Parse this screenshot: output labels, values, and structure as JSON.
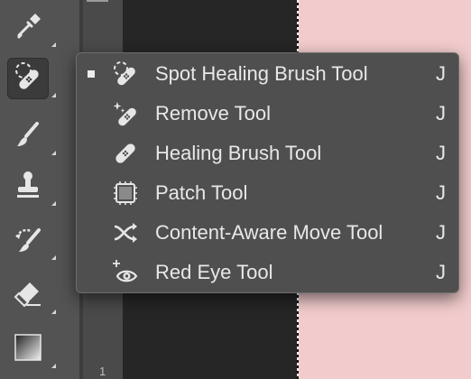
{
  "menu": {
    "items": [
      {
        "label": "Spot Healing Brush Tool",
        "shortcut": "J",
        "checked": true,
        "icon": "spot-healing-brush-icon"
      },
      {
        "label": "Remove Tool",
        "shortcut": "J",
        "checked": false,
        "icon": "remove-tool-icon"
      },
      {
        "label": "Healing Brush Tool",
        "shortcut": "J",
        "checked": false,
        "icon": "healing-brush-icon"
      },
      {
        "label": "Patch Tool",
        "shortcut": "J",
        "checked": false,
        "icon": "patch-tool-icon"
      },
      {
        "label": "Content-Aware Move Tool",
        "shortcut": "J",
        "checked": false,
        "icon": "content-aware-move-icon"
      },
      {
        "label": "Red Eye Tool",
        "shortcut": "J",
        "checked": false,
        "icon": "red-eye-icon"
      }
    ]
  },
  "toolbar": {
    "tools": [
      {
        "icon": "eyedropper-icon"
      },
      {
        "icon": "spot-healing-brush-icon",
        "active": true
      },
      {
        "icon": "brush-icon"
      },
      {
        "icon": "clone-stamp-icon"
      },
      {
        "icon": "history-brush-icon"
      },
      {
        "icon": "eraser-icon"
      },
      {
        "icon": "gradient-icon"
      }
    ]
  },
  "ruler": {
    "label": "1"
  },
  "colors": {
    "toolbar_bg": "#535353",
    "menu_bg": "#4f4f4f",
    "menu_text": "#e8e8e8",
    "canvas_pink": "#f2cccc",
    "canvas_dark": "#262626"
  }
}
